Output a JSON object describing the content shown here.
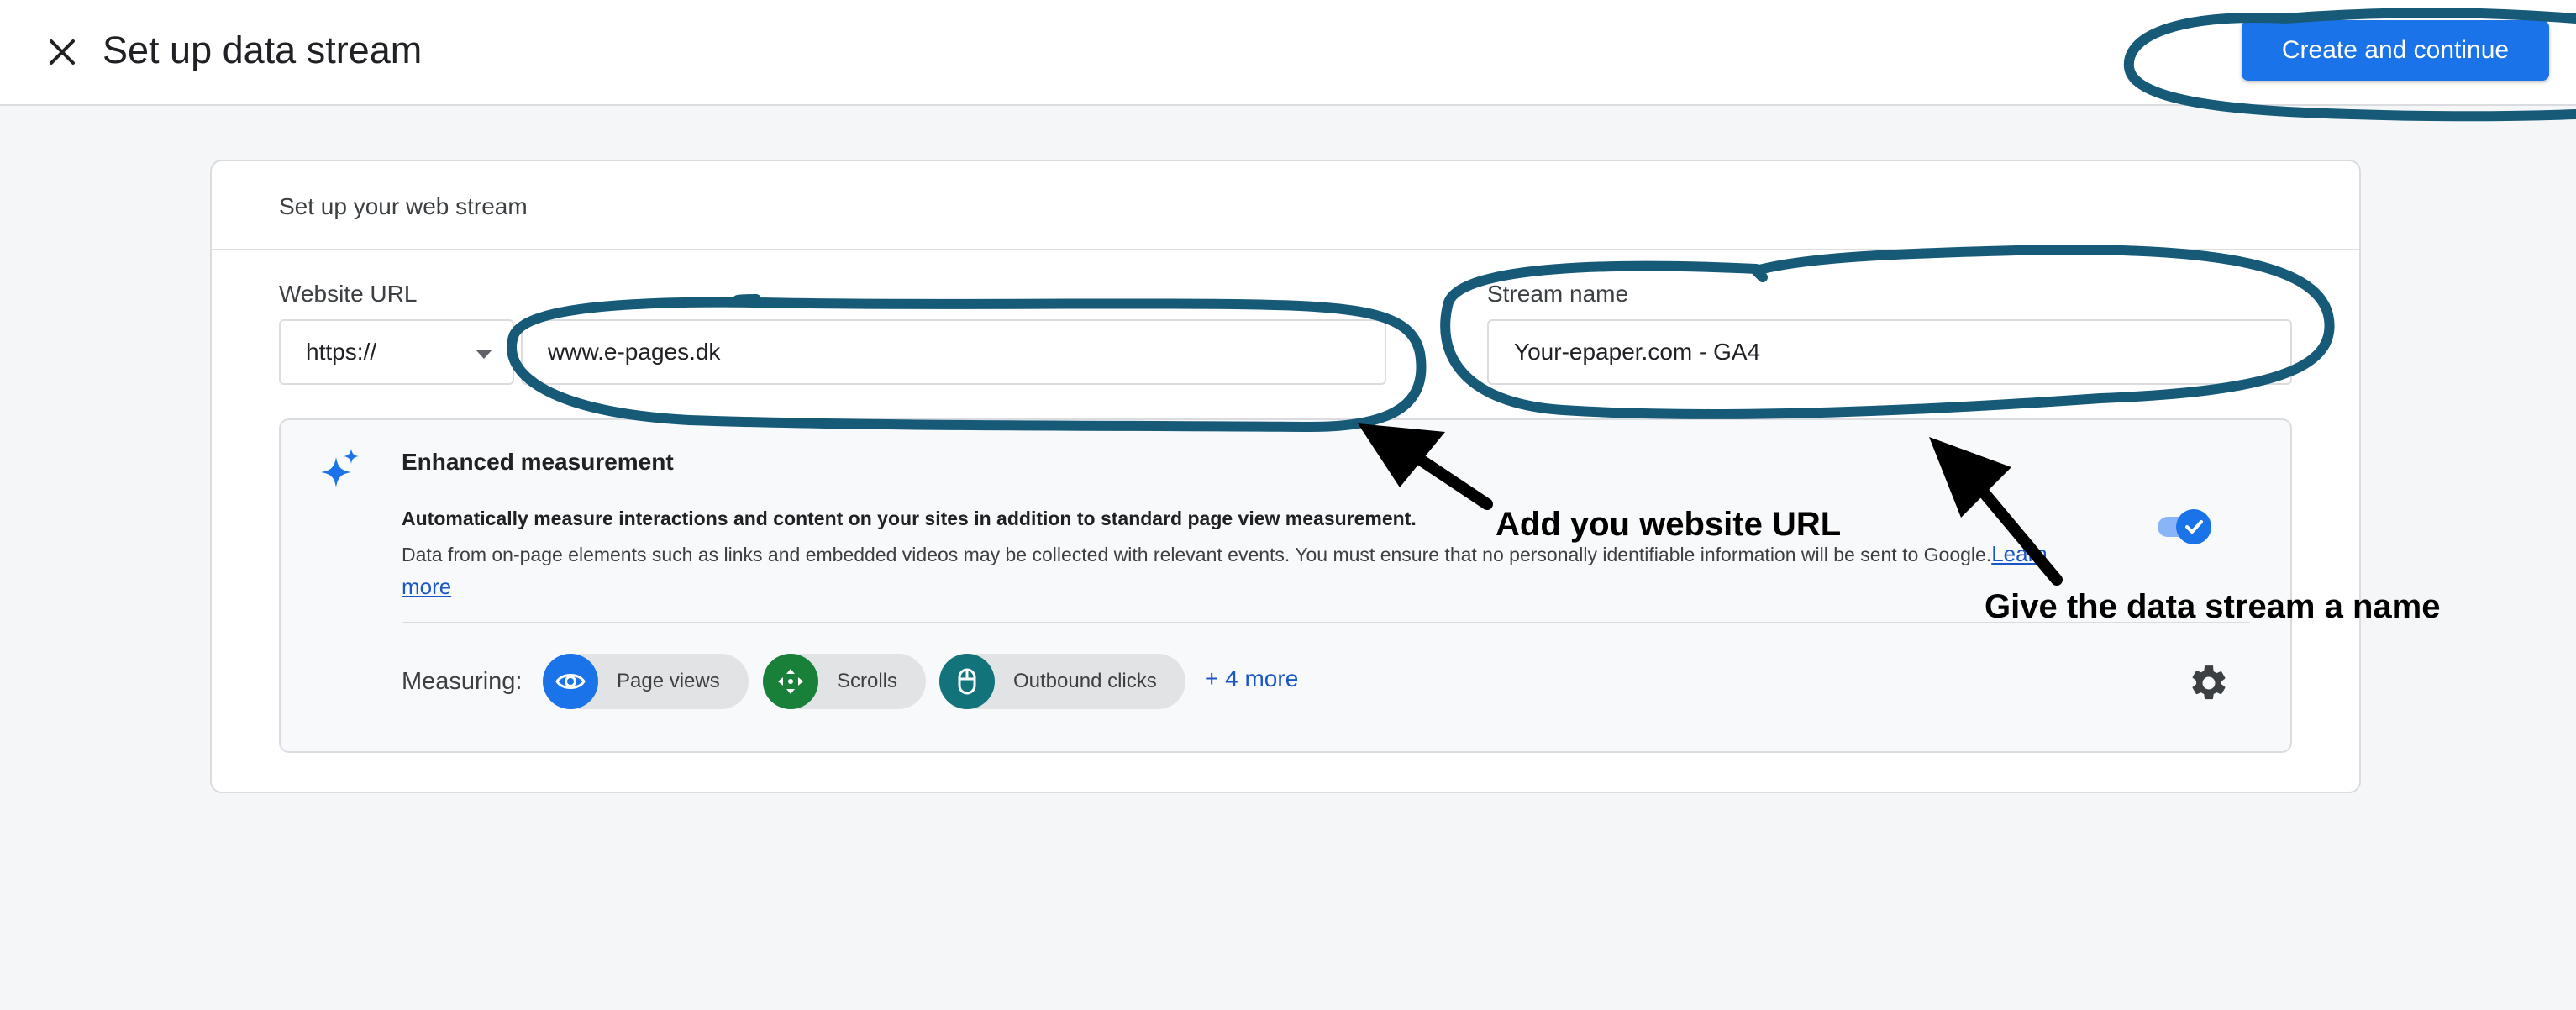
{
  "header": {
    "title": "Set up data stream",
    "primary_button": "Create and continue"
  },
  "card": {
    "title": "Set up your web stream",
    "website_url": {
      "label": "Website URL",
      "protocol": "https://",
      "value": "www.e-pages.dk"
    },
    "stream_name": {
      "label": "Stream name",
      "value": "Your-epaper.com - GA4"
    },
    "enhanced_measurement": {
      "title": "Enhanced measurement",
      "subtitle": "Automatically measure interactions and content on your sites in addition to standard page view measurement.",
      "description": "Data from on-page elements such as links and embedded videos may be collected with relevant events. You must ensure that no personally identifiable information will be sent to Google.",
      "learn_more": "Learn more",
      "enabled": true,
      "measuring_label": "Measuring:",
      "chips": [
        {
          "label": "Page views",
          "icon": "eye-icon",
          "color": "#1a73e8"
        },
        {
          "label": "Scrolls",
          "icon": "scroll-arrows-icon",
          "color": "#188038"
        },
        {
          "label": "Outbound clicks",
          "icon": "mouse-icon",
          "color": "#12737a"
        }
      ],
      "more": "+ 4 more"
    }
  },
  "annotations": {
    "url_hint": "Add you website URL",
    "name_hint": "Give the data stream a name",
    "highlight_color": "#165a78"
  },
  "colors": {
    "accent": "#1a73e8",
    "background": "#f5f6f8"
  }
}
